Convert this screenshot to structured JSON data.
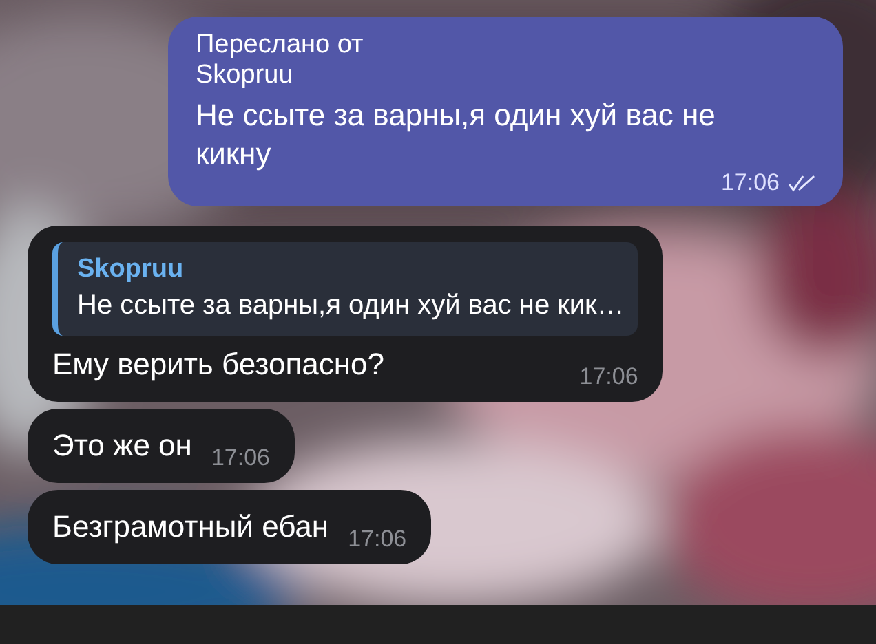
{
  "messages": [
    {
      "kind": "outgoing",
      "forwarded_label": "Переслано от",
      "forwarded_from": "Skopruu",
      "text": "Не ссыте за варны,я один хуй вас не кикну",
      "time": "17:06",
      "read": true
    },
    {
      "kind": "incoming",
      "reply": {
        "author": "Skopruu",
        "text": "Не ссыте за варны,я один хуй вас не кик…"
      },
      "text": "Ему верить безопасно?",
      "time": "17:06"
    },
    {
      "kind": "incoming",
      "text": "Это же он",
      "time": "17:06"
    },
    {
      "kind": "incoming",
      "text": "Безграмотный ебан",
      "time": "17:06"
    }
  ]
}
